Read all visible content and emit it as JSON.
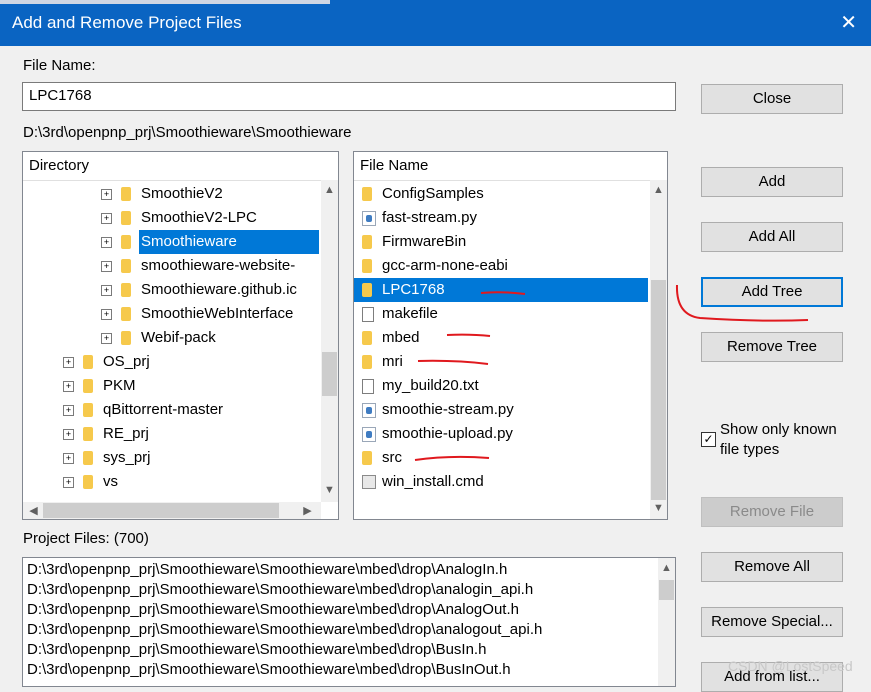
{
  "window": {
    "title": "Add and Remove Project Files",
    "close_symbol": "✕"
  },
  "file_name": {
    "label": "File Name:",
    "value": "LPC1768"
  },
  "current_path": "D:\\3rd\\openpnp_prj\\Smoothieware\\Smoothieware",
  "directory": {
    "header": "Directory",
    "items": [
      {
        "label": "SmoothieV2"
      },
      {
        "label": "SmoothieV2-LPC"
      },
      {
        "label": "Smoothieware"
      },
      {
        "label": "smoothieware-website-"
      },
      {
        "label": "Smoothieware.github.ic"
      },
      {
        "label": "SmoothieWebInterface"
      },
      {
        "label": "Webif-pack"
      },
      {
        "label": "OS_prj"
      },
      {
        "label": "PKM"
      },
      {
        "label": "qBittorrent-master"
      },
      {
        "label": "RE_prj"
      },
      {
        "label": "sys_prj"
      },
      {
        "label": "vs"
      }
    ]
  },
  "files": {
    "header": "File Name",
    "items": [
      {
        "label": "ConfigSamples",
        "icon": "folder-icon"
      },
      {
        "label": "fast-stream.py",
        "icon": "python-file-icon"
      },
      {
        "label": "FirmwareBin",
        "icon": "folder-icon"
      },
      {
        "label": "gcc-arm-none-eabi",
        "icon": "folder-icon"
      },
      {
        "label": "LPC1768",
        "icon": "folder-icon"
      },
      {
        "label": "makefile",
        "icon": "file-icon"
      },
      {
        "label": "mbed",
        "icon": "folder-icon"
      },
      {
        "label": "mri",
        "icon": "folder-icon"
      },
      {
        "label": "my_build20.txt",
        "icon": "text-file-icon"
      },
      {
        "label": "smoothie-stream.py",
        "icon": "python-file-icon"
      },
      {
        "label": "smoothie-upload.py",
        "icon": "python-file-icon"
      },
      {
        "label": "src",
        "icon": "folder-icon"
      },
      {
        "label": "win_install.cmd",
        "icon": "cmd-file-icon"
      }
    ]
  },
  "buttons": {
    "close": "Close",
    "add": "Add",
    "add_all": "Add All",
    "add_tree": "Add Tree",
    "remove_tree": "Remove Tree",
    "remove_file": "Remove File",
    "remove_all": "Remove All",
    "remove_special": "Remove Special...",
    "add_from_list": "Add from list..."
  },
  "show_known": {
    "label_line1": "Show only known",
    "label_line2": "file types",
    "checked": true,
    "mark": "✓"
  },
  "project_files": {
    "label": "Project Files: (700)",
    "items": [
      "D:\\3rd\\openpnp_prj\\Smoothieware\\Smoothieware\\mbed\\drop\\AnalogIn.h",
      "D:\\3rd\\openpnp_prj\\Smoothieware\\Smoothieware\\mbed\\drop\\analogin_api.h",
      "D:\\3rd\\openpnp_prj\\Smoothieware\\Smoothieware\\mbed\\drop\\AnalogOut.h",
      "D:\\3rd\\openpnp_prj\\Smoothieware\\Smoothieware\\mbed\\drop\\analogout_api.h",
      "D:\\3rd\\openpnp_prj\\Smoothieware\\Smoothieware\\mbed\\drop\\BusIn.h",
      "D:\\3rd\\openpnp_prj\\Smoothieware\\Smoothieware\\mbed\\drop\\BusInOut.h"
    ]
  },
  "scroll_arrows": {
    "up": "▲",
    "down": "▼",
    "left": "◀",
    "right": "▶"
  },
  "expander_symbol": "+",
  "watermark": "CSDN @LostSpeed",
  "colors": {
    "titlebar": "#0a64c2",
    "selection": "#0078d7",
    "annotation": "#e0191e"
  }
}
